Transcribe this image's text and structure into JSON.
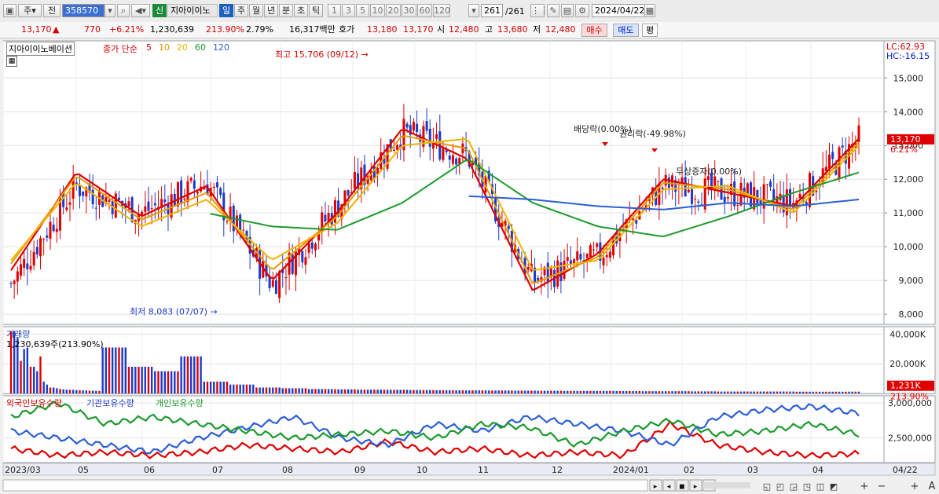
{
  "toolbar": {
    "period_unit": "주",
    "prev_label": "전",
    "code": "358570",
    "stock_badge": "신",
    "stock_name": "지아이이노",
    "period_buttons": [
      "일",
      "주",
      "월",
      "년",
      "분",
      "초",
      "틱"
    ],
    "num_buttons": [
      "1",
      "3",
      "5",
      "10",
      "20",
      "30",
      "60",
      "120"
    ],
    "count": "261",
    "total": "/261",
    "date": "2024/04/22"
  },
  "quote": {
    "price": "13,170",
    "arrow": "▲",
    "change": "770",
    "change_pct": "+6.21%",
    "volume": "1,230,639",
    "volume_ratio": "213.90%",
    "turnover": "2.79%",
    "amount": "16,317백만",
    "bid_label": "호가",
    "ask": "13,180",
    "bid": "13,170",
    "open_label": "시",
    "open": "12,480",
    "high_label": "고",
    "high": "13,680",
    "low_label": "저",
    "low": "12,480",
    "buy_label": "매수",
    "sell_label": "매도",
    "eval_label": "평"
  },
  "legend": {
    "name": "지아이이노베이션",
    "price_ma": "종가 단순",
    "periods": [
      "5",
      "10",
      "20",
      "60",
      "120"
    ],
    "lc": "LC:62.93",
    "hc": "HC:-16.15",
    "volume_title": "거래량",
    "volume_value": "1,230,639주(213.90%)",
    "holders": [
      "외국인보유수량",
      "기관보유수량",
      "개인보유수량"
    ]
  },
  "colors": {
    "ma5": "#e00000",
    "ma10": "#e89a00",
    "ma20": "#f0b400",
    "ma60": "#1c9a2c",
    "ma120": "#2c5fd6",
    "up": "#e00000",
    "down": "#1c39c8",
    "foreign": "#e00000",
    "institution": "#2c5fd6",
    "individual": "#1c9a2c"
  },
  "chart_data": [
    {
      "type": "candlestick",
      "title": "지아이이노베이션 종가 단순 5 10 20 60 120",
      "x_tick_labels": [
        "2023/03",
        "05",
        "06",
        "07",
        "08",
        "09",
        "10",
        "11",
        "12",
        "2024/01",
        "02",
        "03",
        "04",
        "04/22"
      ],
      "y_ticks": [
        8000,
        9000,
        10000,
        11000,
        12000,
        13000,
        14000,
        15000
      ],
      "ylim": [
        7700,
        16100
      ],
      "last_price": 13170,
      "last_price_label": "13,170",
      "last_change_label": "6.21%",
      "series": [
        {
          "name": "종가",
          "x": [
            "2023/03",
            "2023/04",
            "2023/05",
            "2023/06",
            "2023/07",
            "2023/08",
            "2023/09",
            "2023/10",
            "2023/11",
            "2023/12",
            "2024/01",
            "2024/02",
            "2024/03",
            "2024/04"
          ],
          "values": [
            8900,
            11800,
            11000,
            11900,
            8900,
            11200,
            13400,
            12700,
            9000,
            9700,
            11800,
            11600,
            11300,
            13170
          ]
        },
        {
          "name": "5",
          "values": [
            9300,
            12200,
            10900,
            11800,
            9000,
            11000,
            13500,
            12600,
            8700,
            9800,
            12000,
            11600,
            11200,
            13200
          ]
        },
        {
          "name": "10",
          "values": [
            9500,
            12100,
            10800,
            11600,
            9300,
            10900,
            13300,
            12900,
            8900,
            9700,
            11900,
            11700,
            11100,
            13100
          ]
        },
        {
          "name": "20",
          "values": [
            9600,
            11900,
            10600,
            11400,
            9600,
            10700,
            13000,
            13200,
            9300,
            9600,
            11700,
            11800,
            11000,
            13000
          ]
        },
        {
          "name": "60",
          "values": [
            null,
            null,
            null,
            11000,
            10600,
            10500,
            11300,
            12600,
            11300,
            10600,
            10300,
            10900,
            11600,
            12200
          ]
        },
        {
          "name": "120",
          "values": [
            null,
            null,
            null,
            null,
            null,
            null,
            null,
            11500,
            11400,
            11200,
            11100,
            11300,
            11200,
            11400
          ]
        }
      ],
      "annotations": [
        {
          "text": "최고 15,706 (09/12)",
          "value": 15706
        },
        {
          "text": "최저 8,083 (07/07)",
          "value": 8083
        },
        {
          "text": "배당락(0.00%)"
        },
        {
          "text": "권리락(-49.98%)"
        },
        {
          "text": "무상증자(0.00%)"
        }
      ]
    },
    {
      "type": "bar",
      "title": "거래량",
      "y_ticks": [
        "20,000K",
        "40,000K"
      ],
      "last_label": "1,231K",
      "last_pct": "213.90%",
      "values_k": [
        42000,
        38000,
        22000,
        30000,
        31000,
        18000,
        15000,
        25000,
        8000,
        6000,
        4000,
        3500,
        3000,
        2800,
        2600,
        2500,
        2300,
        2200,
        2100,
        2000,
        1900,
        1800,
        1700,
        1700,
        1600,
        1500,
        1500,
        1400,
        1300,
        1300,
        1300,
        1200,
        1200,
        1231
      ]
    },
    {
      "type": "line",
      "title": "보유수량",
      "y_ticks": [
        "2,500,000",
        "3,000,000"
      ],
      "series": [
        {
          "name": "외국인보유수량",
          "values": [
            2350,
            2250,
            2300,
            2250,
            2300,
            2400,
            2350,
            2300,
            2450,
            2300,
            2350,
            2250,
            2300,
            2250,
            2700,
            2400,
            2300,
            2250,
            2280
          ]
        },
        {
          "name": "기관보유수량",
          "values": [
            2600,
            2500,
            2400,
            2300,
            2500,
            2650,
            2800,
            2500,
            2400,
            2700,
            2600,
            2800,
            2700,
            2600,
            2400,
            2800,
            2900,
            2950,
            2850
          ]
        },
        {
          "name": "개인보유수량",
          "values": [
            2800,
            3000,
            2700,
            2800,
            2700,
            2600,
            2500,
            2550,
            2600,
            2500,
            2700,
            2650,
            2400,
            2600,
            2750,
            2550,
            2600,
            2700,
            2550
          ]
        }
      ]
    }
  ]
}
